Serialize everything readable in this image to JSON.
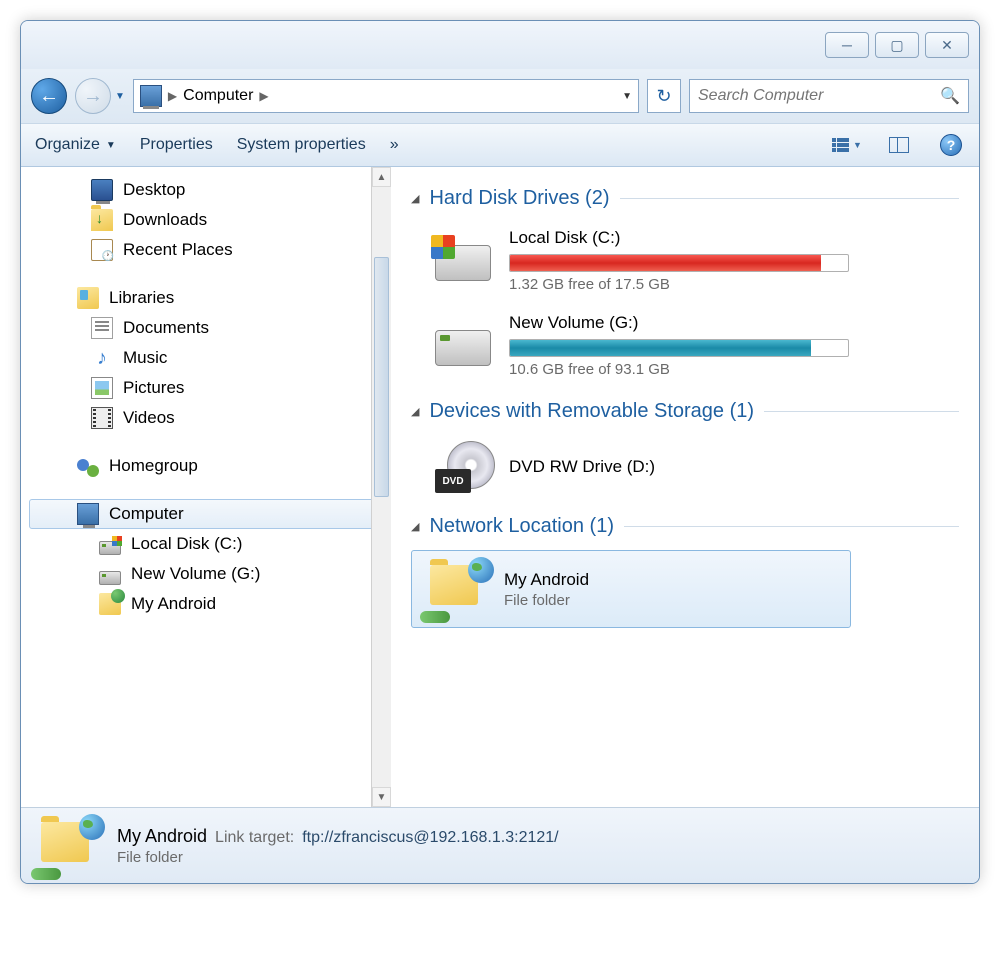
{
  "window": {
    "minimize": "─",
    "maximize": "▢",
    "close": "✕"
  },
  "nav": {
    "back": "←",
    "forward": "→",
    "breadcrumb_location": "Computer",
    "refresh": "↻",
    "search_placeholder": "Search Computer"
  },
  "toolbar": {
    "organize": "Organize",
    "properties": "Properties",
    "system_properties": "System properties",
    "overflow": "»",
    "help": "?"
  },
  "sidebar": {
    "favorites": [
      {
        "label": "Desktop"
      },
      {
        "label": "Downloads"
      },
      {
        "label": "Recent Places"
      }
    ],
    "libraries_label": "Libraries",
    "libraries": [
      {
        "label": "Documents"
      },
      {
        "label": "Music"
      },
      {
        "label": "Pictures"
      },
      {
        "label": "Videos"
      }
    ],
    "homegroup": "Homegroup",
    "computer": "Computer",
    "drives": [
      {
        "label": "Local Disk (C:)"
      },
      {
        "label": "New Volume (G:)"
      },
      {
        "label": "My Android"
      }
    ]
  },
  "main": {
    "groups": {
      "hdd": {
        "title": "Hard Disk Drives (2)"
      },
      "removable": {
        "title": "Devices with Removable Storage (1)"
      },
      "network": {
        "title": "Network Location (1)"
      }
    },
    "hdd": [
      {
        "name": "Local Disk (C:)",
        "stat": "1.32 GB free of 17.5 GB",
        "fill_pct": 92,
        "fill_class": "fill-red"
      },
      {
        "name": "New Volume (G:)",
        "stat": "10.6 GB free of 93.1 GB",
        "fill_pct": 89,
        "fill_class": "fill-teal"
      }
    ],
    "removable": [
      {
        "name": "DVD RW Drive (D:)",
        "badge": "DVD"
      }
    ],
    "network": [
      {
        "name": "My Android",
        "type": "File folder"
      }
    ]
  },
  "status": {
    "name": "My Android",
    "link_label": "Link target:",
    "link_value": "ftp://zfranciscus@192.168.1.3:2121/",
    "type": "File folder"
  }
}
